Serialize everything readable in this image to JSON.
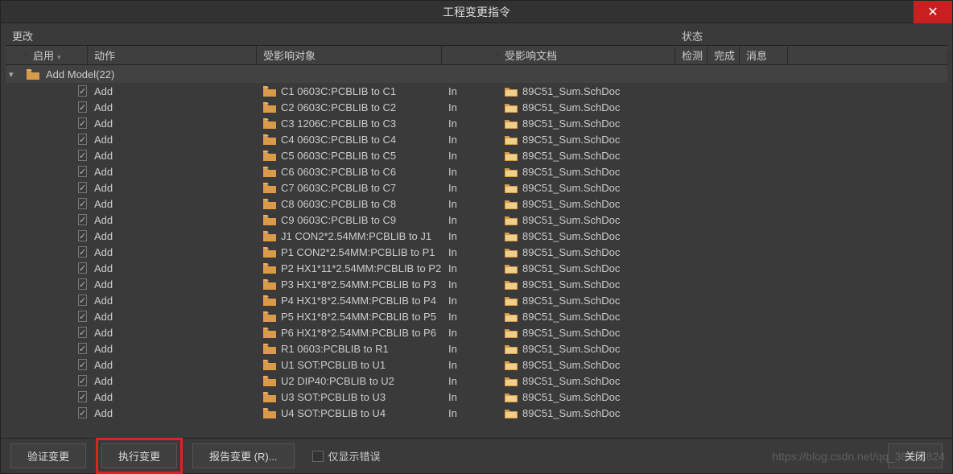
{
  "dialog": {
    "title": "工程变更指令"
  },
  "columns": {
    "change": "更改",
    "status": "状态",
    "enable": "启用",
    "action": "动作",
    "object": "受影响对象",
    "document": "受影响文档",
    "detect": "检测",
    "done": "完成",
    "message": "消息"
  },
  "group": {
    "label": "Add Model(22)"
  },
  "in_text": "In",
  "doc_name": "89C51_Sum.SchDoc",
  "rows": [
    {
      "action": "Add",
      "object": "C1 0603C:PCBLIB to C1"
    },
    {
      "action": "Add",
      "object": "C2 0603C:PCBLIB to C2"
    },
    {
      "action": "Add",
      "object": "C3 1206C:PCBLIB to C3"
    },
    {
      "action": "Add",
      "object": "C4 0603C:PCBLIB to C4"
    },
    {
      "action": "Add",
      "object": "C5 0603C:PCBLIB to C5"
    },
    {
      "action": "Add",
      "object": "C6 0603C:PCBLIB to C6"
    },
    {
      "action": "Add",
      "object": "C7 0603C:PCBLIB to C7"
    },
    {
      "action": "Add",
      "object": "C8 0603C:PCBLIB to C8"
    },
    {
      "action": "Add",
      "object": "C9 0603C:PCBLIB to C9"
    },
    {
      "action": "Add",
      "object": "J1 CON2*2.54MM:PCBLIB to J1"
    },
    {
      "action": "Add",
      "object": "P1 CON2*2.54MM:PCBLIB to P1"
    },
    {
      "action": "Add",
      "object": "P2 HX1*11*2.54MM:PCBLIB to P2"
    },
    {
      "action": "Add",
      "object": "P3 HX1*8*2.54MM:PCBLIB to P3"
    },
    {
      "action": "Add",
      "object": "P4 HX1*8*2.54MM:PCBLIB to P4"
    },
    {
      "action": "Add",
      "object": "P5 HX1*8*2.54MM:PCBLIB to P5"
    },
    {
      "action": "Add",
      "object": "P6 HX1*8*2.54MM:PCBLIB to P6"
    },
    {
      "action": "Add",
      "object": "R1 0603:PCBLIB to R1"
    },
    {
      "action": "Add",
      "object": "U1 SOT:PCBLIB to U1"
    },
    {
      "action": "Add",
      "object": "U2 DIP40:PCBLIB to U2"
    },
    {
      "action": "Add",
      "object": "U3 SOT:PCBLIB to U3"
    },
    {
      "action": "Add",
      "object": "U4 SOT:PCBLIB to U4"
    }
  ],
  "footer": {
    "validate": "验证变更",
    "execute": "执行变更",
    "report": "报告变更 (R)...",
    "only_errors": "仅显示错误",
    "close": "关闭"
  },
  "watermark": "https://blog.csdn.net/qq_38351824"
}
